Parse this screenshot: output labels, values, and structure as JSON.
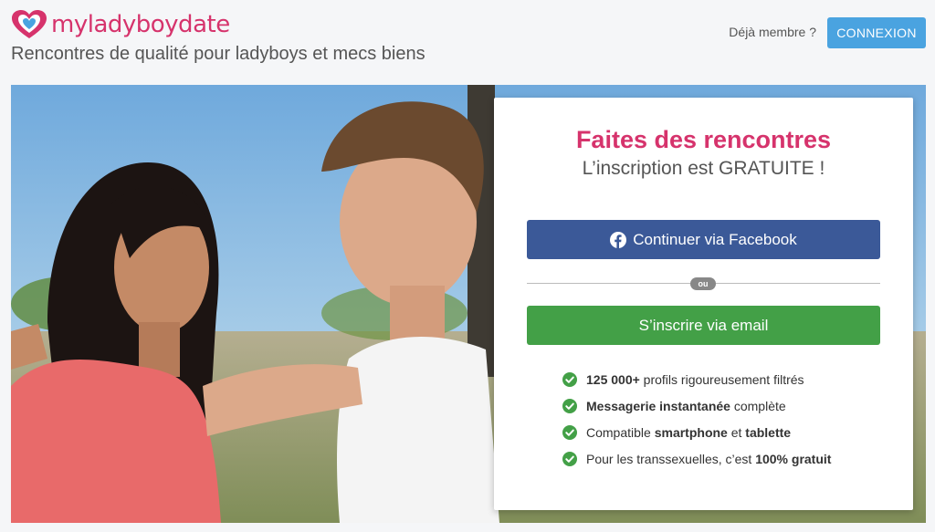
{
  "header": {
    "logo_text": "myladyboydate",
    "tagline": "Rencontres de qualité pour ladyboys et mecs biens",
    "member_text": "Déjà membre ?",
    "login_label": "CONNEXION"
  },
  "card": {
    "title": "Faites des rencontres",
    "subtitle": "L’inscription est GRATUITE !",
    "facebook_label": "Continuer via Facebook",
    "or_label": "ou",
    "email_label": "S’inscrire via email",
    "features": [
      {
        "bold": "125 000+",
        "rest": " profils rigoureusement filtrés"
      },
      {
        "bold": "Messagerie instantanée",
        "rest": " complète"
      },
      {
        "pre": "Compatible ",
        "bold": "smartphone",
        "mid": " et ",
        "bold2": "tablette"
      },
      {
        "pre": "Pour les transsexuelles, c’est ",
        "bold": "100% gratuit"
      }
    ]
  },
  "colors": {
    "brand": "#d6336c",
    "login_button": "#4aa3e0",
    "facebook": "#3b5998",
    "email_button": "#43a047",
    "check": "#43a047"
  },
  "icons": [
    "heart-logo-icon",
    "facebook-icon",
    "check-circle-icon"
  ]
}
